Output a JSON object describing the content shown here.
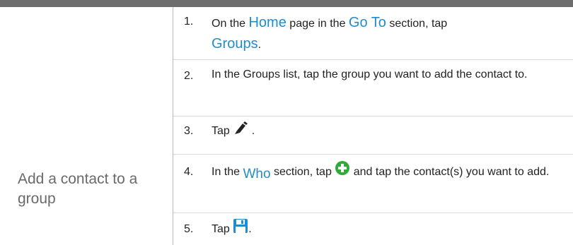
{
  "task": {
    "label": "Add a contact to a group"
  },
  "steps": [
    {
      "num": "1.",
      "t1": "On the ",
      "link1": "Home",
      "t2": " page in the ",
      "link2": "Go To",
      "t3": " section, tap",
      "link3": "Groups",
      "t4": "."
    },
    {
      "num": "2.",
      "text": "In the Groups list, tap the group you want to add the contact to."
    },
    {
      "num": "3.",
      "t1": "Tap ",
      "icon": "pencil-icon",
      "t2": " ."
    },
    {
      "num": "4.",
      "t1": "In the ",
      "link1": "Who",
      "t2": " section, tap ",
      "icon": "add-circle-icon",
      "t3": " and tap the contact(s) you want to add."
    },
    {
      "num": "5.",
      "t1": "Tap ",
      "icon": "save-icon",
      "t2": "."
    }
  ],
  "colors": {
    "link": "#1f8dcc",
    "add_icon": "#2faa3b",
    "save_icon": "#1f8dcc",
    "header_bar": "#6d6d6d"
  }
}
